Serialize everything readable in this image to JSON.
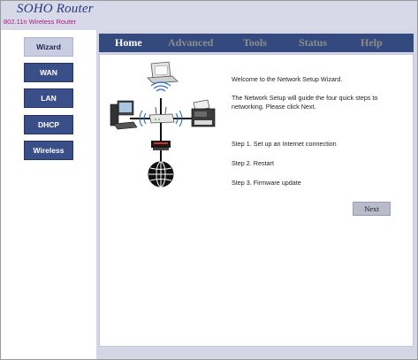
{
  "header": {
    "title": "SOHO Router",
    "subtitle": "802.11n Wireless Router"
  },
  "sidebar": {
    "items": [
      {
        "label": "Wizard",
        "active": true
      },
      {
        "label": "WAN"
      },
      {
        "label": "LAN"
      },
      {
        "label": "DHCP"
      },
      {
        "label": "Wireless"
      }
    ]
  },
  "nav": {
    "tabs": [
      {
        "label": "Home",
        "active": true
      },
      {
        "label": "Advanced"
      },
      {
        "label": "Tools"
      },
      {
        "label": "Status"
      },
      {
        "label": "Help"
      }
    ]
  },
  "main": {
    "welcome": "Welcome to the Network Setup Wizard.",
    "intro": "The Network Setup will guide the four quick steps to networking. Please click Next.",
    "steps": [
      "Step 1. Set up an Internet connection",
      "Step 2. Restart",
      "Step 3. Firmware update"
    ],
    "next_label": "Next"
  },
  "colors": {
    "nav_bg": "#34497e",
    "sidebar_button": "#3a4f88",
    "subtitle": "#b01a80",
    "title": "#2b3a7a"
  }
}
